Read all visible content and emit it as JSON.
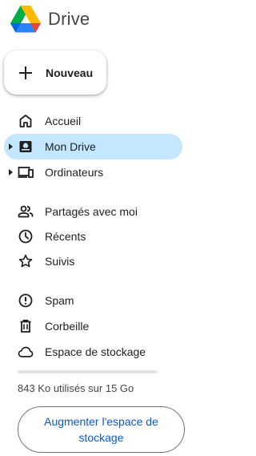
{
  "app": {
    "title": "Drive"
  },
  "new_button": {
    "label": "Nouveau",
    "icon": "plus-icon"
  },
  "nav": {
    "items": [
      {
        "id": "accueil",
        "label": "Accueil",
        "icon": "home-icon",
        "active": false,
        "expandable": false
      },
      {
        "id": "mon-drive",
        "label": "Mon Drive",
        "icon": "my-drive-icon",
        "active": true,
        "expandable": true
      },
      {
        "id": "ordinateurs",
        "label": "Ordinateurs",
        "icon": "computers-icon",
        "active": false,
        "expandable": true
      },
      {
        "id": "partages",
        "label": "Partagés avec moi",
        "icon": "shared-people-icon",
        "active": false,
        "expandable": false
      },
      {
        "id": "recents",
        "label": "Récents",
        "icon": "clock-icon",
        "active": false,
        "expandable": false
      },
      {
        "id": "suivis",
        "label": "Suivis",
        "icon": "star-icon",
        "active": false,
        "expandable": false
      },
      {
        "id": "spam",
        "label": "Spam",
        "icon": "spam-icon",
        "active": false,
        "expandable": false
      },
      {
        "id": "corbeille",
        "label": "Corbeille",
        "icon": "trash-icon",
        "active": false,
        "expandable": false
      },
      {
        "id": "stockage",
        "label": "Espace de stockage",
        "icon": "cloud-icon",
        "active": false,
        "expandable": false
      }
    ]
  },
  "storage": {
    "used_text": "843 Ko utilisés sur 15 Go",
    "used_fraction": 6e-05,
    "upgrade_label": "Augmenter l'espace de stockage"
  },
  "colors": {
    "accent": "#0b57d0",
    "active_bg": "#c2e7ff",
    "text": "#1f1f1f"
  }
}
